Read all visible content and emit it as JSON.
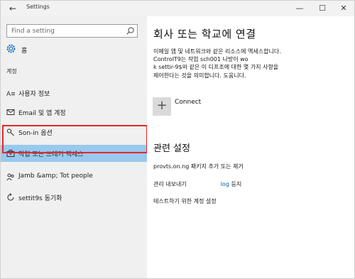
{
  "window": {
    "title": "Settings",
    "back_glyph": "←",
    "minimize_glyph": "—",
    "maximize_glyph": "☐",
    "close_glyph": "✕"
  },
  "sidebar": {
    "search_placeholder": "Find a setting",
    "home_label": "홈",
    "section_label": "계정",
    "items": [
      {
        "label": "사용자 정보",
        "icon": "user-info-icon"
      },
      {
        "label": "Email 및 앱 계정",
        "icon": "email-icon"
      },
      {
        "label": "Son-in 옵션",
        "icon": "key-icon"
      },
      {
        "label": "작업 또는 쓰레기 액세스",
        "icon": "briefcase-icon",
        "selected": true
      },
      {
        "label": "Jamb &amp; Tot people",
        "icon": "people-icon"
      },
      {
        "label": "settit9s 동기화",
        "icon": "sync-icon"
      }
    ]
  },
  "main": {
    "title": "회사 또는 학교에 연결",
    "description_lines": [
      "이메일 앱 및 네트워크와 같은 리소스에 액세스합니다.",
      "ControlT9는 작업 sch001 나방이 wo",
      "k settir-9$와 같은 이 디프조에 대한 몇 가지 사항을",
      "제어한다는 것을 의미합니다. 도움니다."
    ],
    "connect_label": "Connect",
    "related_title": "관련 설정",
    "links": {
      "provisioning": "provts.on.ng 패키지 추가 또는 제거",
      "export_prefix": "관리 내보내기",
      "export_accent": "log",
      "export_suffix": "등지",
      "test_setup": "테스트하기 위한 계정 설정"
    }
  },
  "colors": {
    "selected_bg": "#99c9ee",
    "highlight_border": "#e0282c",
    "accent": "#0063b1",
    "sidebar_bg": "#f0f0f0"
  }
}
